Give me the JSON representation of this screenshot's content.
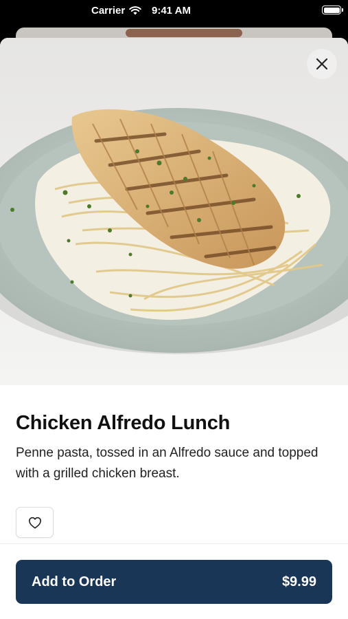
{
  "status_bar": {
    "carrier": "Carrier",
    "time": "9:41 AM"
  },
  "item": {
    "title": "Chicken Alfredo Lunch",
    "description": "Penne pasta, tossed in an Alfredo sauce and topped with a grilled chicken breast."
  },
  "actions": {
    "add_label": "Add to Order",
    "price": "$9.99"
  },
  "icons": {
    "close": "close-icon",
    "favorite": "heart-icon",
    "wifi": "wifi-icon",
    "battery": "battery-icon"
  },
  "colors": {
    "primary": "#1a3657",
    "text": "#111111"
  }
}
